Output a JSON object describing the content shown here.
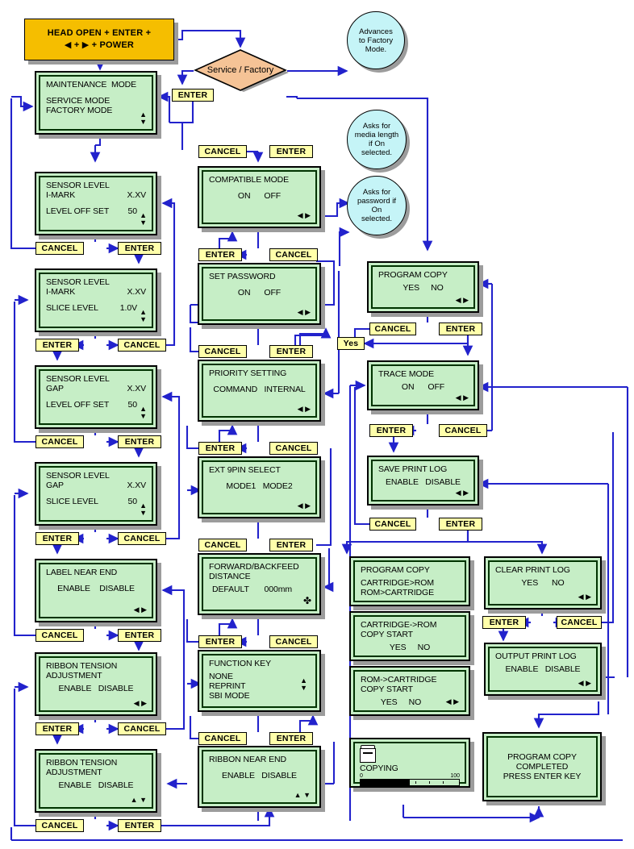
{
  "title": "Service / Factory Mode Flow Diagram",
  "colors": {
    "lcd_bg": "#c6eec6",
    "key_bg": "#ffffaa",
    "start_bg": "#f5be00",
    "note_bg": "#c5f4f7",
    "decision_bg": "#f5c396",
    "wire": "#2222cc",
    "shadow": "#9c9c9c"
  },
  "start": {
    "line1": "HEAD OPEN + ENTER +",
    "line2_prefix": "◀  +  ▶  + POWER"
  },
  "decision": {
    "label": "Service / Factory"
  },
  "notes": [
    {
      "id": "note-factory",
      "lines": [
        "Advances",
        "to Factory",
        "Mode."
      ]
    },
    {
      "id": "note-media-length",
      "lines": [
        "Asks for",
        "media length",
        "if On",
        "selected."
      ]
    },
    {
      "id": "note-password",
      "lines": [
        "Asks for",
        "password if",
        "On",
        "selected."
      ]
    }
  ],
  "keys": {
    "enter": "ENTER",
    "cancel": "CANCEL",
    "yes": "Yes"
  },
  "screens": {
    "maintenance_mode": {
      "title": "MAINTENANCE  MODE",
      "options": [
        "SERVICE MODE",
        "FACTORY MODE"
      ],
      "indicator": "up-down"
    },
    "sensor_level_imark_offset": {
      "title": "SENSOR LEVEL",
      "subtitle": "I-MARK",
      "value_top": "X.XV",
      "field": "LEVEL OFF SET",
      "value": "50",
      "indicator": "up-down"
    },
    "sensor_level_imark_slice": {
      "title": "SENSOR LEVEL",
      "subtitle": "I-MARK",
      "value_top": "X.XV",
      "field": "SLICE LEVEL",
      "value": "1.0V",
      "indicator": "up-down"
    },
    "sensor_level_gap_offset": {
      "title": "SENSOR LEVEL",
      "subtitle": "GAP",
      "value_top": "X.XV",
      "field": "LEVEL OFF SET",
      "value": "50",
      "indicator": "up-down"
    },
    "sensor_level_gap_slice": {
      "title": "SENSOR LEVEL",
      "subtitle": "GAP",
      "value_top": "X.XV",
      "field": "SLICE LEVEL",
      "value": "50",
      "indicator": "up-down"
    },
    "label_near_end": {
      "title": "LABEL NEAR END",
      "options": "ENABLE    DISABLE",
      "indicator": "left-right"
    },
    "ribbon_tension_1": {
      "title": "RIBBON TENSION",
      "title2": "ADJUSTMENT",
      "options": "ENABLE   DISABLE",
      "indicator": "left-right"
    },
    "ribbon_tension_2": {
      "title": "RIBBON TENSION",
      "title2": "ADJUSTMENT",
      "options": "ENABLE   DISABLE",
      "indicator": "up-down"
    },
    "compatible_mode": {
      "title": "COMPATIBLE MODE",
      "options": "ON      OFF",
      "indicator": "left-right"
    },
    "set_password": {
      "title": "SET PASSWORD",
      "options": "ON      OFF",
      "indicator": "left-right"
    },
    "priority_setting": {
      "title": "PRIORITY SETTING",
      "options": "COMMAND   INTERNAL",
      "indicator": "left-right"
    },
    "ext_9pin_select": {
      "title": "EXT 9PIN SELECT",
      "options": "MODE1   MODE2",
      "indicator": "left-right"
    },
    "forward_backfeed": {
      "title": "FORWARD/BACKFEED",
      "title2": "DISTANCE",
      "field": "DEFAULT",
      "value": "000mm",
      "indicator": "four-way"
    },
    "function_key": {
      "title": "FUNCTION KEY",
      "options": [
        "NONE",
        "REPRINT",
        "SBI MODE"
      ],
      "indicator": "up-down"
    },
    "ribbon_near_end": {
      "title": "RIBBON NEAR END",
      "options": "ENABLE   DISABLE",
      "indicator": "up-down"
    },
    "program_copy_yesno": {
      "title": "PROGRAM COPY",
      "options": "YES     NO",
      "indicator": "left-right"
    },
    "trace_mode": {
      "title": "TRACE MODE",
      "options": "ON      OFF",
      "indicator": "left-right"
    },
    "save_print_log": {
      "title": "SAVE PRINT LOG",
      "options": "ENABLE   DISABLE",
      "indicator": "left-right"
    },
    "program_copy_menu": {
      "title": "PROGRAM COPY",
      "options": [
        "CARTRIDGE>ROM",
        "ROM>CARTRIDGE"
      ]
    },
    "cartridge_to_rom": {
      "title": "CARTRIDGE->ROM",
      "title2": "COPY START",
      "options": "YES     NO"
    },
    "rom_to_cartridge": {
      "title": "ROM->CARTRIDGE",
      "title2": "COPY START",
      "options": "YES     NO",
      "indicator": "left-right-inline"
    },
    "copying": {
      "label": "COPYING",
      "scale_min": "0",
      "scale_max": "100",
      "progress_percent": 50,
      "icon": "cartridge-icon"
    },
    "clear_print_log": {
      "title": "CLEAR PRINT LOG",
      "options": "YES      NO",
      "indicator": "left-right"
    },
    "output_print_log": {
      "title": "OUTPUT PRINT LOG",
      "options": "ENABLE   DISABLE",
      "indicator": "left-right"
    },
    "program_copy_completed": {
      "line1": "PROGRAM COPY",
      "line2": "COMPLETED",
      "line3": "PRESS ENTER KEY"
    }
  }
}
